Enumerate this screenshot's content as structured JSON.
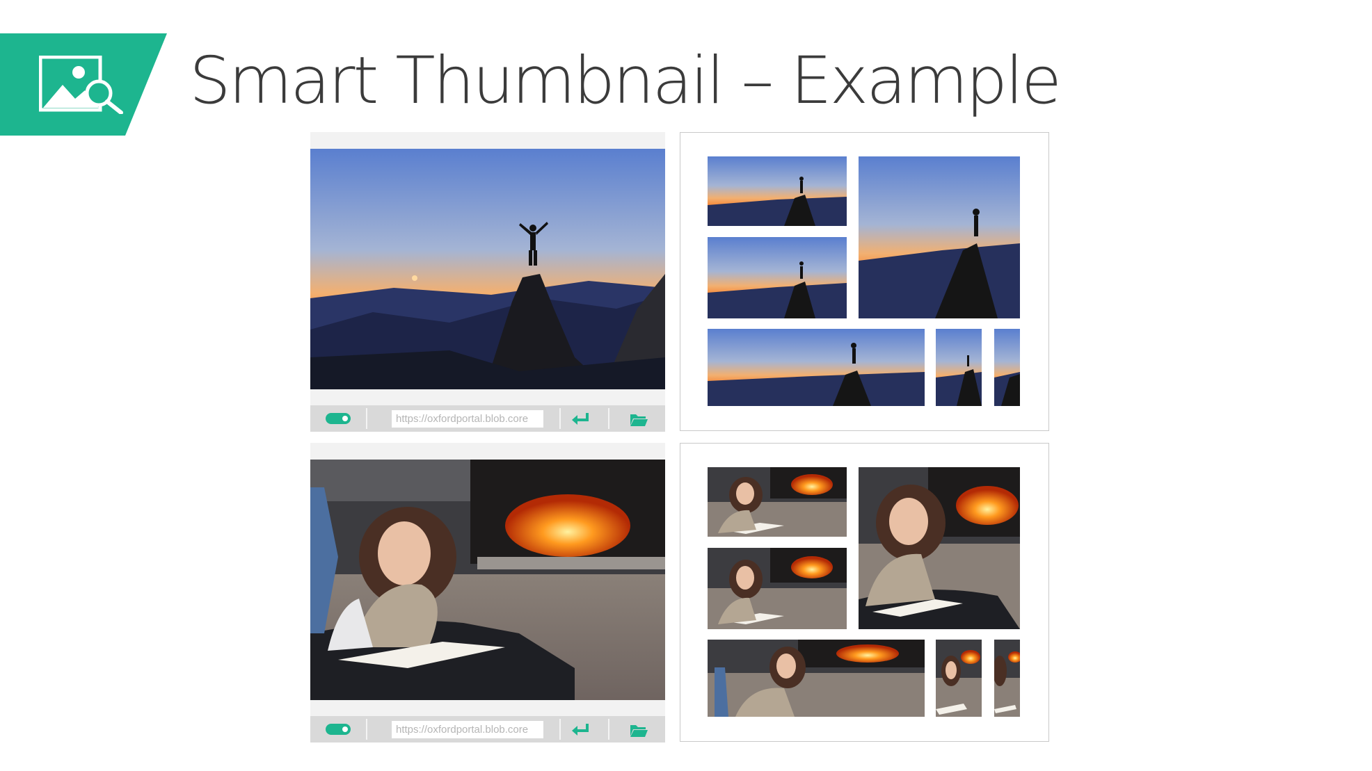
{
  "slide": {
    "title": "Smart Thumbnail – Example",
    "accent_color": "#1db58f",
    "logo_icon": "image-search-icon"
  },
  "examples": [
    {
      "scene": "mountain-sunset",
      "viewer": {
        "url_value": "https://oxfordportal.blob.core",
        "toggle_icon": "toggle-on-icon",
        "submit_icon": "enter-arrow-icon",
        "folder_icon": "folder-open-icon"
      },
      "thumbnails": [
        "wide-crop",
        "square-crop",
        "wide-crop",
        "panorama-crop",
        "tall-crop",
        "narrow-crop"
      ]
    },
    {
      "scene": "woman-reading-by-fireplace",
      "viewer": {
        "url_value": "https://oxfordportal.blob.core",
        "toggle_icon": "toggle-on-icon",
        "submit_icon": "enter-arrow-icon",
        "folder_icon": "folder-open-icon"
      },
      "thumbnails": [
        "wide-crop",
        "square-crop",
        "wide-crop",
        "panorama-crop",
        "tall-crop",
        "narrow-crop"
      ]
    }
  ]
}
